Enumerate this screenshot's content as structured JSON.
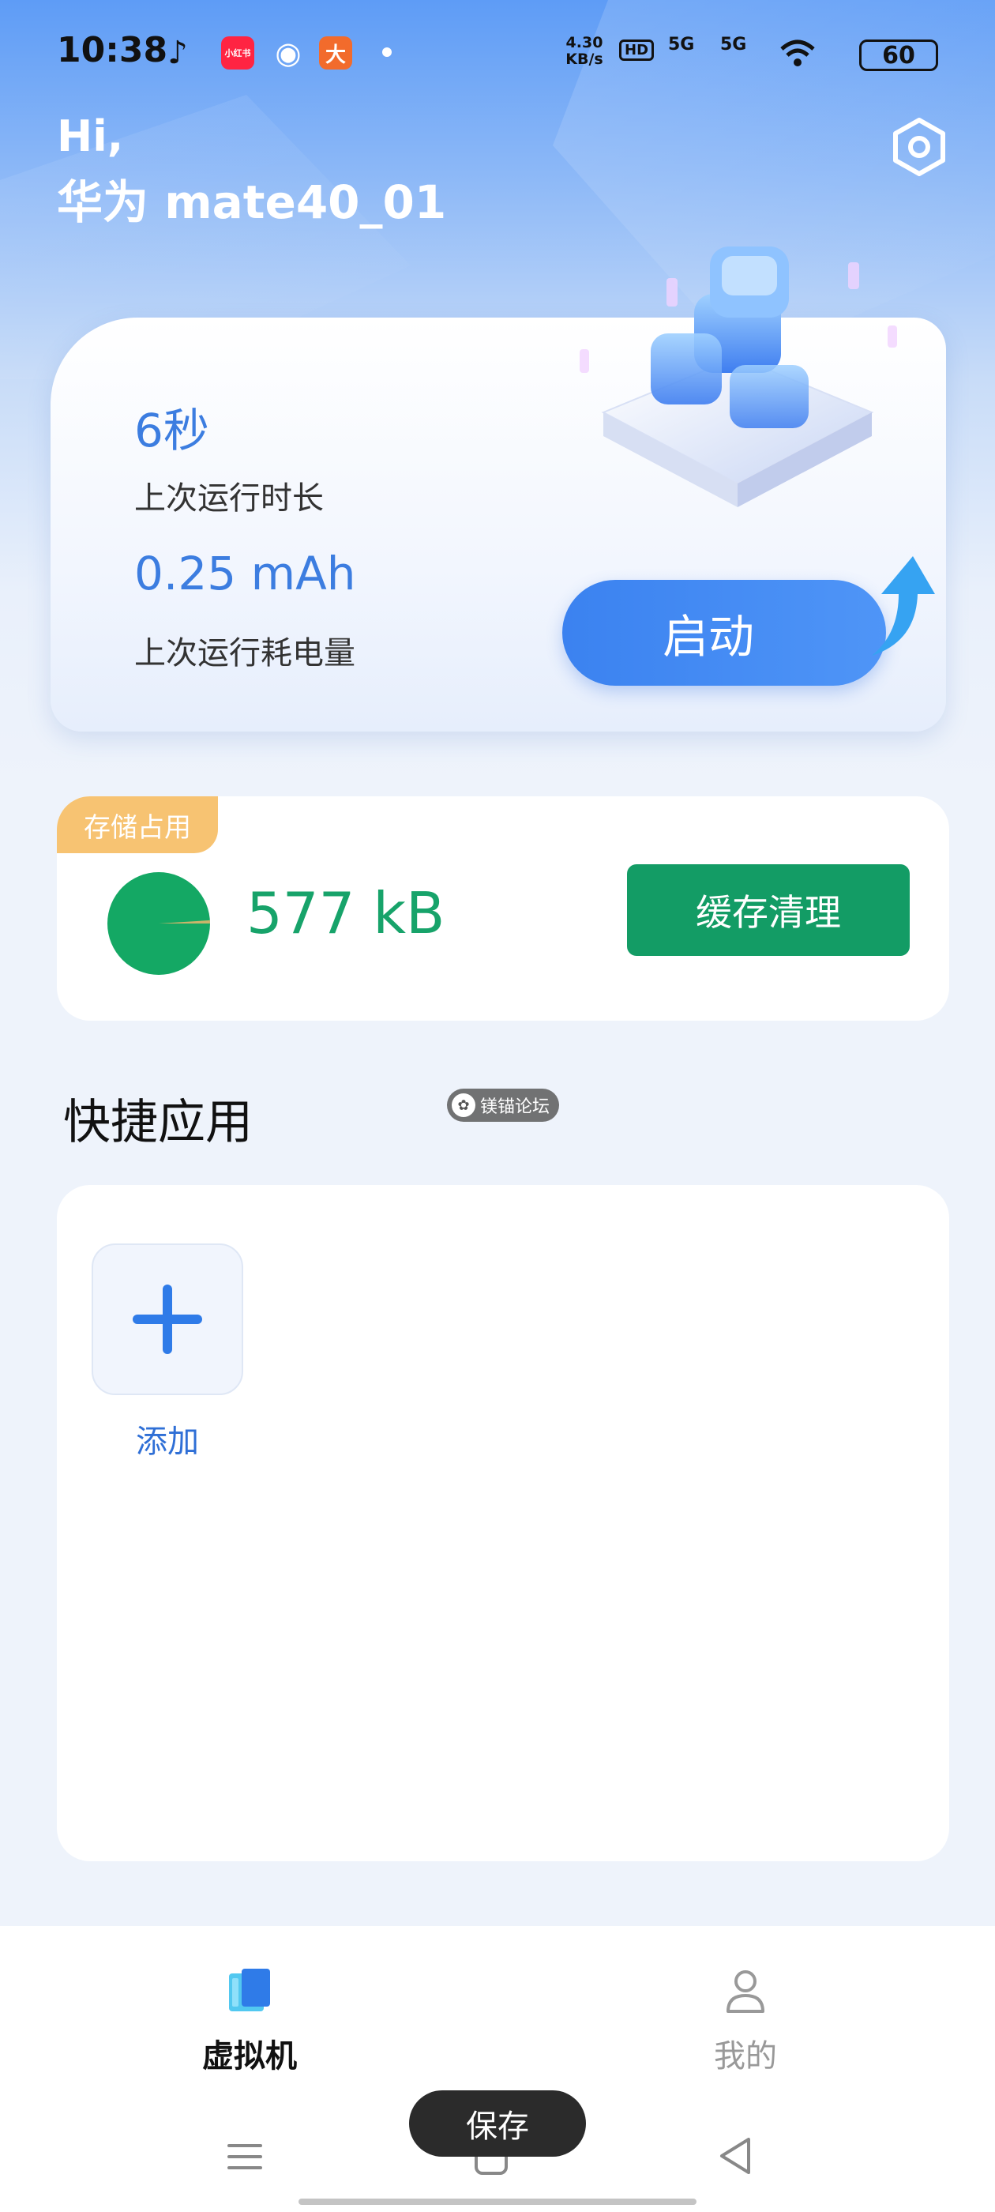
{
  "status_bar": {
    "time": "10:38",
    "apps": [
      {
        "name": "tiktok-icon",
        "glyph": "♪",
        "color": "#111111"
      },
      {
        "name": "xiaohongshu-icon",
        "glyph": "小红书",
        "color": "#ff2442"
      },
      {
        "name": "wechat-icon",
        "glyph": "◉",
        "color": "#ffffff"
      },
      {
        "name": "app-notification-icon",
        "glyph": "大",
        "color": "#f26b2c"
      }
    ],
    "net_speed": "4.30\nKB/s",
    "hd": "HD",
    "signal_1": "5G",
    "signal_2": "5G",
    "battery": "60"
  },
  "greeting": {
    "hi": "Hi,",
    "device_name": "华为 mate40_01"
  },
  "run_card": {
    "duration_value": "6秒",
    "duration_label": "上次运行时长",
    "power_value": "0.25 mAh",
    "power_label": "上次运行耗电量",
    "start_label": "启动"
  },
  "storage": {
    "badge": "存储占用",
    "size": "577 kB",
    "clear_label": "缓存清理",
    "usage_fraction": 0.01,
    "colors": {
      "used": "#c9b46a",
      "free": "#14a864"
    }
  },
  "quick_apps": {
    "title": "快捷应用",
    "add_label": "添加"
  },
  "watermark": {
    "text": "镁锚论坛"
  },
  "nav": {
    "items": [
      {
        "label": "虚拟机",
        "active": true
      },
      {
        "label": "我的",
        "active": false
      }
    ]
  },
  "toast": {
    "text": "保存"
  }
}
